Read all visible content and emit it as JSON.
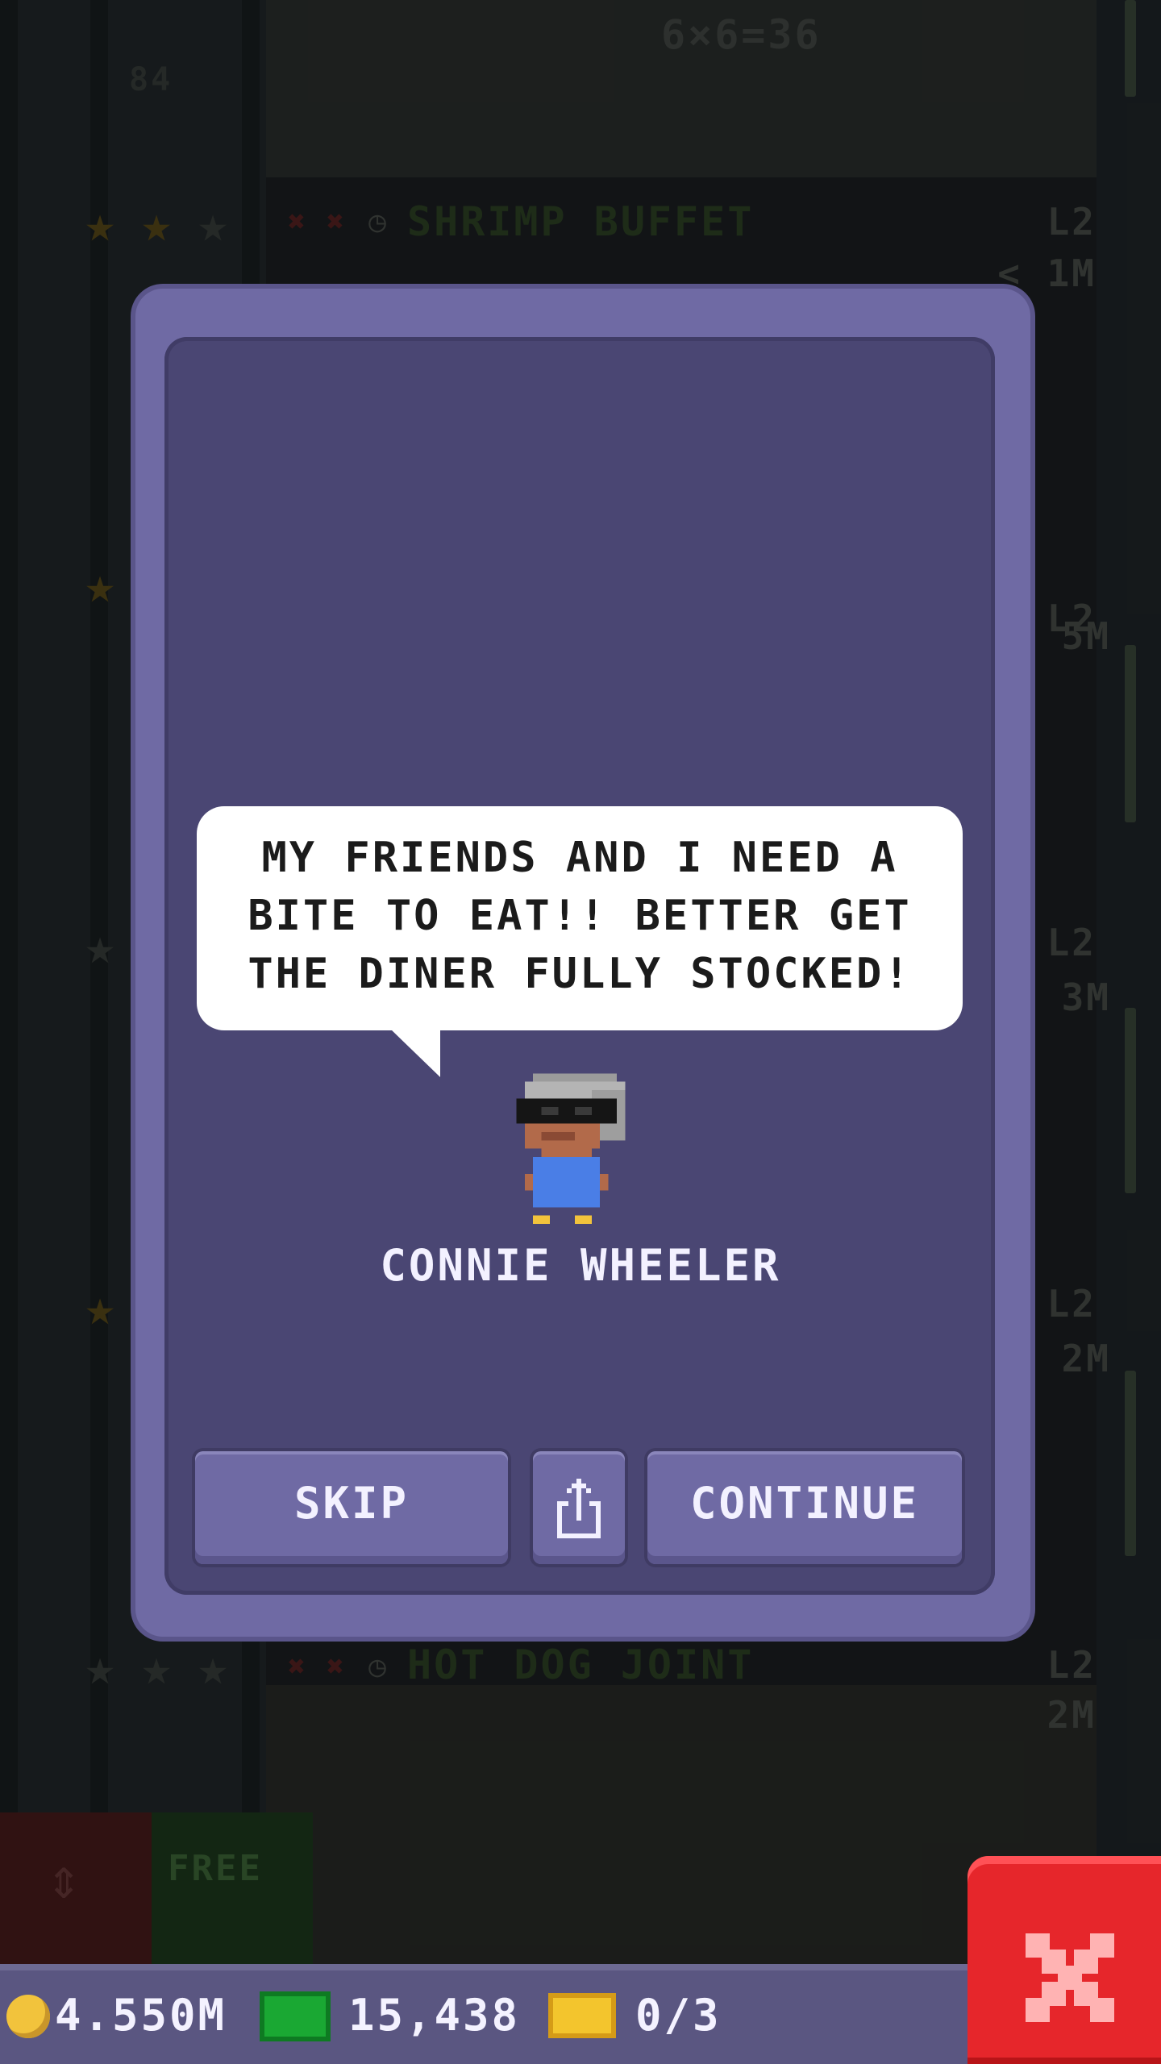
{
  "background": {
    "floors": [
      {
        "name": "SHRIMP BUFFET",
        "level": "L2",
        "cost": "< 1M",
        "stars": 2
      },
      {
        "name": "HOT DOG JOINT",
        "level": "L2",
        "cost": "2M",
        "stars": 0
      }
    ],
    "top_sign": "6×6=36",
    "left_floor_number": "84",
    "side_levels": [
      {
        "level": "L2",
        "cost": "5M"
      },
      {
        "level": "L2",
        "cost": "3M"
      },
      {
        "level": "L2",
        "cost": "2M"
      }
    ],
    "free_label": "FREE"
  },
  "dialog": {
    "speech": "MY FRIENDS AND I NEED A\nBITE TO EAT!! BETTER GET\nTHE DINER FULLY STOCKED!",
    "character_name": "CONNIE WHEELER",
    "skip_label": "SKIP",
    "continue_label": "CONTINUE",
    "share_icon": "share-icon"
  },
  "status_bar": {
    "coins": "4.550M",
    "bux": "15,438",
    "tickets": "0/3"
  },
  "colors": {
    "dialog_frame": "#6f6aa4",
    "dialog_panel": "#4a4673",
    "close_button": "#e6262b"
  }
}
